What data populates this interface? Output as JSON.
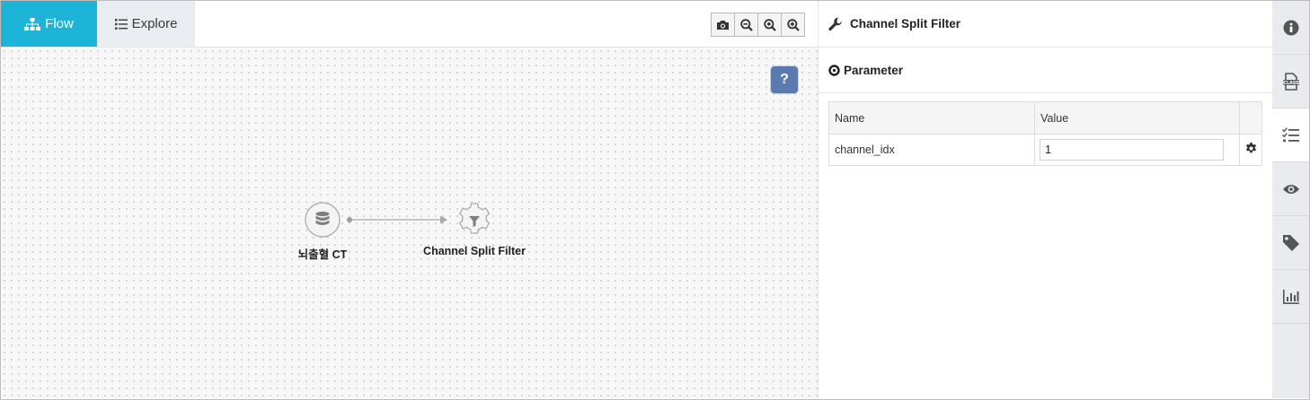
{
  "tabs": [
    {
      "label": "Flow",
      "icon": "sitemap-icon",
      "active": true
    },
    {
      "label": "Explore",
      "icon": "list-icon",
      "active": false
    }
  ],
  "toolbar": {
    "icons": [
      "camera-icon",
      "zoom-out-icon",
      "zoom-fit-icon",
      "zoom-in-icon"
    ]
  },
  "canvas": {
    "help_label": "?",
    "nodes": [
      {
        "label": "뇌출혈 CT",
        "icon": "database-icon"
      },
      {
        "label": "Channel Split Filter",
        "icon": "filter-gear-icon"
      }
    ]
  },
  "panel": {
    "title": "Channel Split Filter",
    "title_icon": "wrench-icon",
    "section_title": "Parameter",
    "section_icon": "circle-dot-icon",
    "table": {
      "headers": [
        "Name",
        "Value"
      ],
      "rows": [
        {
          "name": "channel_idx",
          "value": "1"
        }
      ]
    }
  },
  "rail": {
    "icons": [
      "info-icon",
      "class-file-icon",
      "checklist-icon",
      "eye-icon",
      "tag-icon",
      "bar-chart-icon"
    ],
    "active_index": 2
  },
  "colors": {
    "accent": "#1cb5d8",
    "help_button": "#5b7bb0"
  }
}
